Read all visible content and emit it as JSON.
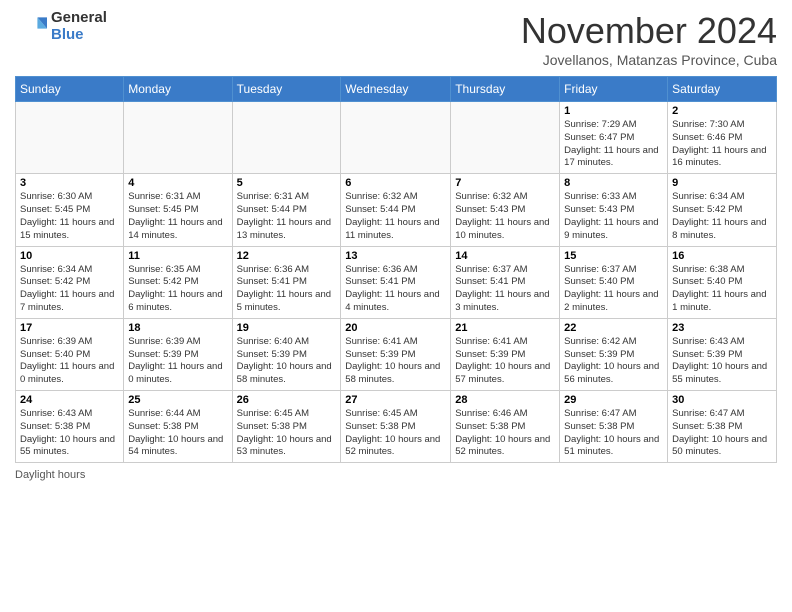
{
  "header": {
    "logo_general": "General",
    "logo_blue": "Blue",
    "month_title": "November 2024",
    "location": "Jovellanos, Matanzas Province, Cuba"
  },
  "footer": {
    "daylight_label": "Daylight hours"
  },
  "weekdays": [
    "Sunday",
    "Monday",
    "Tuesday",
    "Wednesday",
    "Thursday",
    "Friday",
    "Saturday"
  ],
  "weeks": [
    [
      {
        "day": "",
        "info": ""
      },
      {
        "day": "",
        "info": ""
      },
      {
        "day": "",
        "info": ""
      },
      {
        "day": "",
        "info": ""
      },
      {
        "day": "",
        "info": ""
      },
      {
        "day": "1",
        "info": "Sunrise: 7:29 AM\nSunset: 6:47 PM\nDaylight: 11 hours and 17 minutes."
      },
      {
        "day": "2",
        "info": "Sunrise: 7:30 AM\nSunset: 6:46 PM\nDaylight: 11 hours and 16 minutes."
      }
    ],
    [
      {
        "day": "3",
        "info": "Sunrise: 6:30 AM\nSunset: 5:45 PM\nDaylight: 11 hours and 15 minutes."
      },
      {
        "day": "4",
        "info": "Sunrise: 6:31 AM\nSunset: 5:45 PM\nDaylight: 11 hours and 14 minutes."
      },
      {
        "day": "5",
        "info": "Sunrise: 6:31 AM\nSunset: 5:44 PM\nDaylight: 11 hours and 13 minutes."
      },
      {
        "day": "6",
        "info": "Sunrise: 6:32 AM\nSunset: 5:44 PM\nDaylight: 11 hours and 11 minutes."
      },
      {
        "day": "7",
        "info": "Sunrise: 6:32 AM\nSunset: 5:43 PM\nDaylight: 11 hours and 10 minutes."
      },
      {
        "day": "8",
        "info": "Sunrise: 6:33 AM\nSunset: 5:43 PM\nDaylight: 11 hours and 9 minutes."
      },
      {
        "day": "9",
        "info": "Sunrise: 6:34 AM\nSunset: 5:42 PM\nDaylight: 11 hours and 8 minutes."
      }
    ],
    [
      {
        "day": "10",
        "info": "Sunrise: 6:34 AM\nSunset: 5:42 PM\nDaylight: 11 hours and 7 minutes."
      },
      {
        "day": "11",
        "info": "Sunrise: 6:35 AM\nSunset: 5:42 PM\nDaylight: 11 hours and 6 minutes."
      },
      {
        "day": "12",
        "info": "Sunrise: 6:36 AM\nSunset: 5:41 PM\nDaylight: 11 hours and 5 minutes."
      },
      {
        "day": "13",
        "info": "Sunrise: 6:36 AM\nSunset: 5:41 PM\nDaylight: 11 hours and 4 minutes."
      },
      {
        "day": "14",
        "info": "Sunrise: 6:37 AM\nSunset: 5:41 PM\nDaylight: 11 hours and 3 minutes."
      },
      {
        "day": "15",
        "info": "Sunrise: 6:37 AM\nSunset: 5:40 PM\nDaylight: 11 hours and 2 minutes."
      },
      {
        "day": "16",
        "info": "Sunrise: 6:38 AM\nSunset: 5:40 PM\nDaylight: 11 hours and 1 minute."
      }
    ],
    [
      {
        "day": "17",
        "info": "Sunrise: 6:39 AM\nSunset: 5:40 PM\nDaylight: 11 hours and 0 minutes."
      },
      {
        "day": "18",
        "info": "Sunrise: 6:39 AM\nSunset: 5:39 PM\nDaylight: 11 hours and 0 minutes."
      },
      {
        "day": "19",
        "info": "Sunrise: 6:40 AM\nSunset: 5:39 PM\nDaylight: 10 hours and 58 minutes."
      },
      {
        "day": "20",
        "info": "Sunrise: 6:41 AM\nSunset: 5:39 PM\nDaylight: 10 hours and 58 minutes."
      },
      {
        "day": "21",
        "info": "Sunrise: 6:41 AM\nSunset: 5:39 PM\nDaylight: 10 hours and 57 minutes."
      },
      {
        "day": "22",
        "info": "Sunrise: 6:42 AM\nSunset: 5:39 PM\nDaylight: 10 hours and 56 minutes."
      },
      {
        "day": "23",
        "info": "Sunrise: 6:43 AM\nSunset: 5:39 PM\nDaylight: 10 hours and 55 minutes."
      }
    ],
    [
      {
        "day": "24",
        "info": "Sunrise: 6:43 AM\nSunset: 5:38 PM\nDaylight: 10 hours and 55 minutes."
      },
      {
        "day": "25",
        "info": "Sunrise: 6:44 AM\nSunset: 5:38 PM\nDaylight: 10 hours and 54 minutes."
      },
      {
        "day": "26",
        "info": "Sunrise: 6:45 AM\nSunset: 5:38 PM\nDaylight: 10 hours and 53 minutes."
      },
      {
        "day": "27",
        "info": "Sunrise: 6:45 AM\nSunset: 5:38 PM\nDaylight: 10 hours and 52 minutes."
      },
      {
        "day": "28",
        "info": "Sunrise: 6:46 AM\nSunset: 5:38 PM\nDaylight: 10 hours and 52 minutes."
      },
      {
        "day": "29",
        "info": "Sunrise: 6:47 AM\nSunset: 5:38 PM\nDaylight: 10 hours and 51 minutes."
      },
      {
        "day": "30",
        "info": "Sunrise: 6:47 AM\nSunset: 5:38 PM\nDaylight: 10 hours and 50 minutes."
      }
    ]
  ]
}
